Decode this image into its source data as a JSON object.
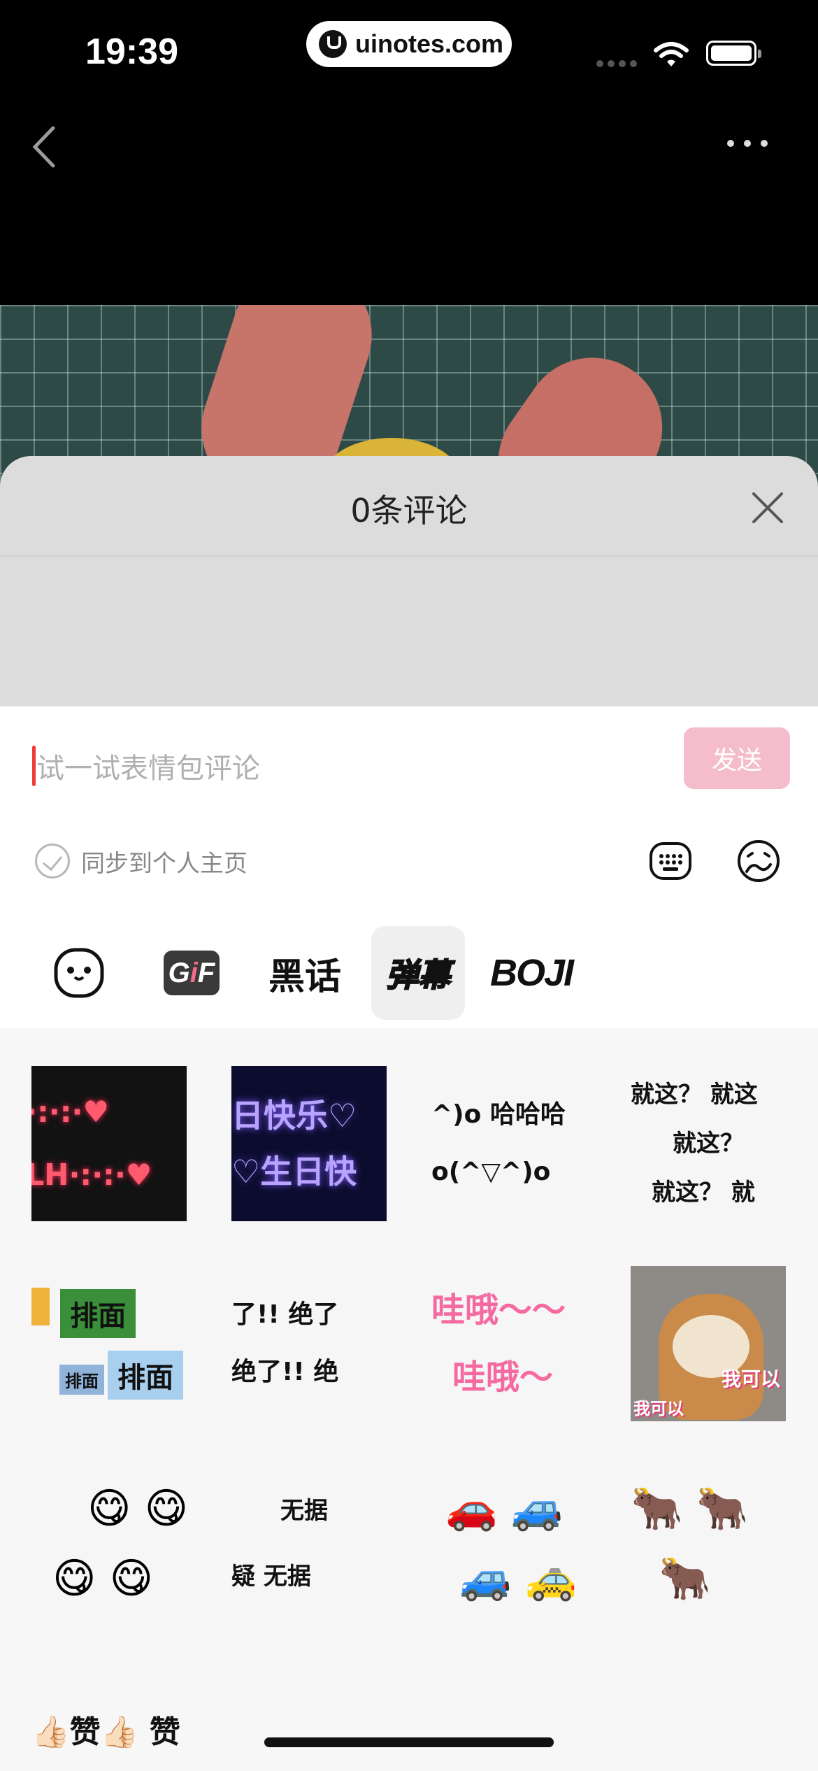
{
  "status_bar": {
    "time": "19:39",
    "url": "uinotes.com"
  },
  "comments": {
    "title": "0条评论",
    "input_placeholder": "试一试表情包评论",
    "send_label": "发送",
    "sync_label": "同步到个人主页"
  },
  "sticker_tabs": [
    {
      "name": "emoji-face",
      "label": ""
    },
    {
      "name": "gif",
      "label": "GiF"
    },
    {
      "name": "heihua",
      "label": "黑话"
    },
    {
      "name": "danmu",
      "label": "弹幕",
      "active": true
    },
    {
      "name": "boji",
      "label": "BOJI"
    }
  ],
  "stickers": {
    "s1": {
      "line1": "·:·:·♥",
      "line2": "ᒪᕼ·:·:·♥"
    },
    "s2": {
      "line1": "日快乐♡",
      "line2": "♡生日快"
    },
    "s3": {
      "line1": "^)o 哈哈哈",
      "line2": "o(^▽^)o"
    },
    "s4": {
      "line1": "就这？  就这",
      "line2": "就这？",
      "line3": "就这？  就"
    },
    "s5": {
      "line1": "排面",
      "line2": "排面",
      "line3": "排面"
    },
    "s6": {
      "line1": "了!!  绝了",
      "line2": "绝了!!  绝"
    },
    "s7": {
      "line1": "哇哦～～",
      "line2": "哇哦～"
    },
    "s8": {
      "caption1": "我可以",
      "caption2": "我可以"
    },
    "s9": {
      "line1": "😋 😋",
      "line2": "😋  😋"
    },
    "s10": {
      "line1": "无据",
      "line2": "疑 无据"
    },
    "s11": {
      "line1": "🚗  🚙",
      "line2": "🚙 🚕"
    },
    "s12": {
      "line1": "🐂  🐂",
      "line2": "🐂"
    },
    "s13": {
      "text": "👍🏻赞👍🏻 赞"
    }
  },
  "colors": {
    "accent_send": "#f5bccb",
    "caret": "#ee3b3b"
  }
}
